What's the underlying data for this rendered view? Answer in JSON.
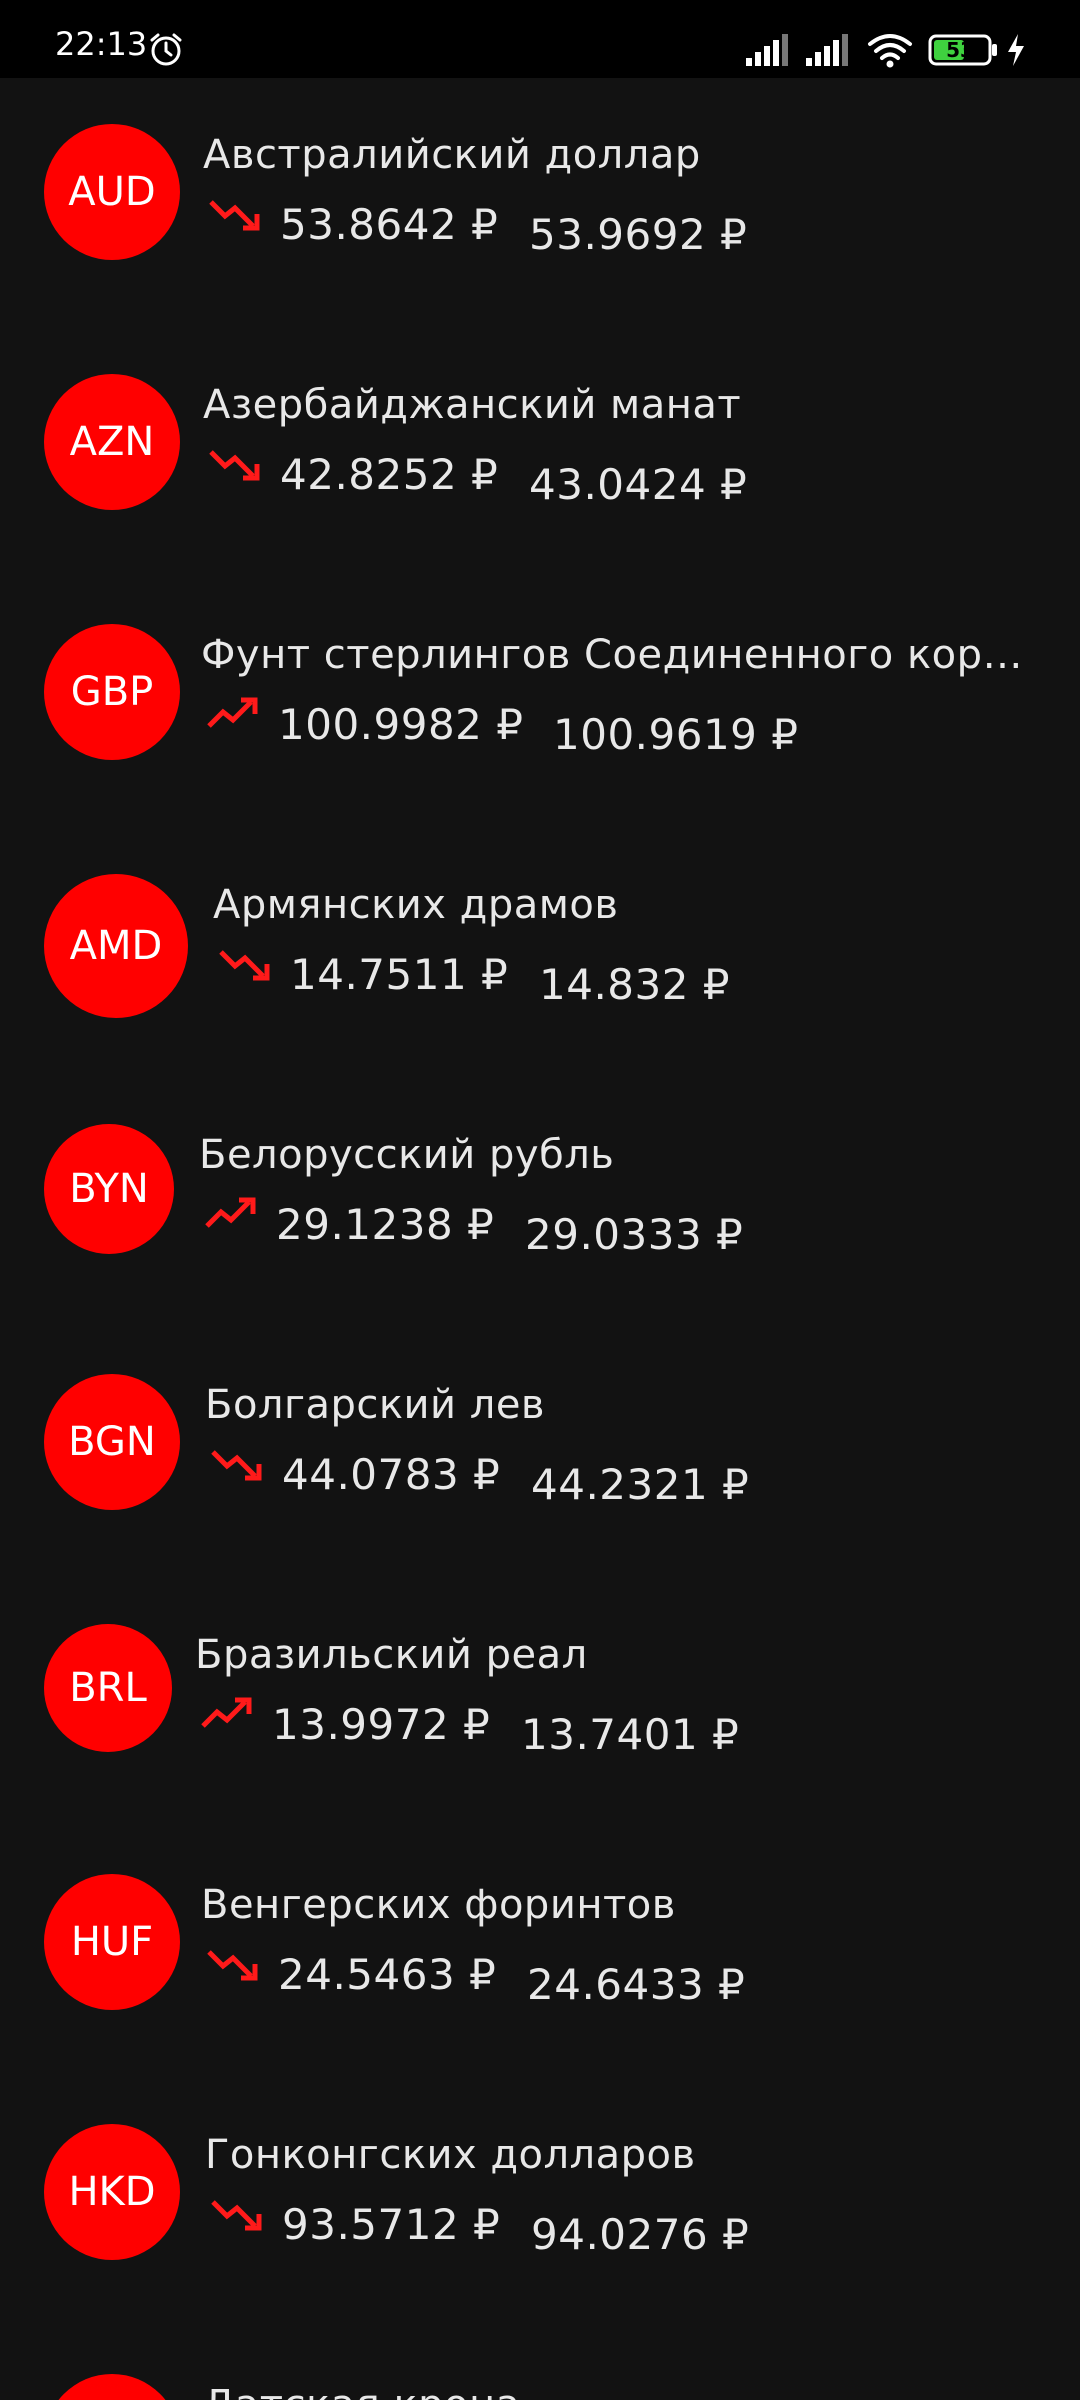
{
  "status_bar": {
    "time": "22:13",
    "battery": "53"
  },
  "colors": {
    "accent": "#ff0000",
    "background": "#121212"
  },
  "currencies": [
    {
      "code": "AUD",
      "name": "Австралийский доллар",
      "trend": "down",
      "value1": "53.8642 ₽",
      "value2": "53.9692 ₽"
    },
    {
      "code": "AZN",
      "name": "Азербайджанский манат",
      "trend": "down",
      "value1": "42.8252 ₽",
      "value2": "43.0424 ₽"
    },
    {
      "code": "GBP",
      "name": "Фунт стерлингов Соединенного кор…",
      "trend": "up",
      "value1": "100.9982 ₽",
      "value2": "100.9619 ₽"
    },
    {
      "code": "AMD",
      "name": "Армянских драмов",
      "trend": "down",
      "value1": "14.7511 ₽",
      "value2": "14.832 ₽"
    },
    {
      "code": "BYN",
      "name": "Белорусский рубль",
      "trend": "up",
      "value1": "29.1238 ₽",
      "value2": "29.0333 ₽"
    },
    {
      "code": "BGN",
      "name": "Болгарский лев",
      "trend": "down",
      "value1": "44.0783 ₽",
      "value2": "44.2321 ₽"
    },
    {
      "code": "BRL",
      "name": "Бразильский реал",
      "trend": "up",
      "value1": "13.9972 ₽",
      "value2": "13.7401 ₽"
    },
    {
      "code": "HUF",
      "name": "Венгерских форинтов",
      "trend": "down",
      "value1": "24.5463 ₽",
      "value2": "24.6433 ₽"
    },
    {
      "code": "HKD",
      "name": "Гонконгских долларов",
      "trend": "down",
      "value1": "93.5712 ₽",
      "value2": "94.0276 ₽"
    },
    {
      "code": "",
      "name": "Датская крона",
      "trend": "",
      "value1": "",
      "value2": ""
    }
  ]
}
